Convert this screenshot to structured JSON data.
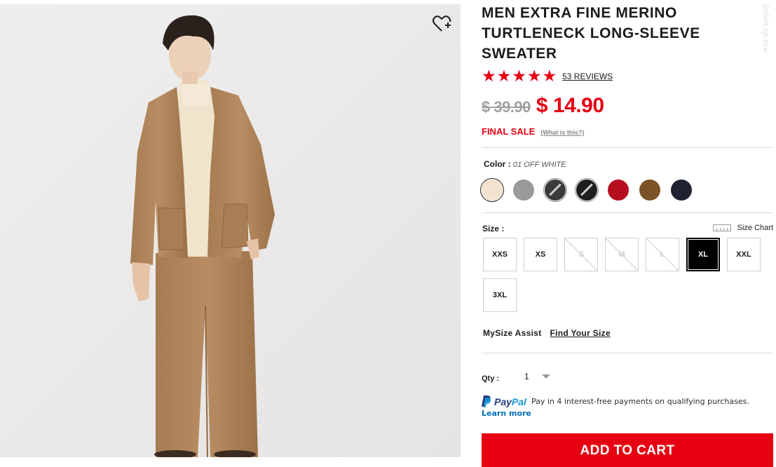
{
  "product": {
    "title": "MEN EXTRA FINE MERINO TURTLENECK LONG-SLEEVE SWEATER",
    "rating_stars": 5,
    "reviews": "53 REVIEWS",
    "original_price": "$ 39.90",
    "sale_price": "$ 14.90",
    "sale_label": "FINAL SALE",
    "sale_help": "(What is this?)",
    "watermark": "ladies.ep.nsw"
  },
  "color": {
    "label": "Color :",
    "selected": "01 OFF WHITE",
    "swatches": [
      {
        "name": "off-white",
        "hex": "#f2e3d0",
        "selected": true
      },
      {
        "name": "gray",
        "hex": "#9a9a9a"
      },
      {
        "name": "dark-gray",
        "hex": "#3a3a3a"
      },
      {
        "name": "black",
        "hex": "#1e1e1e"
      },
      {
        "name": "red",
        "hex": "#b50f1e"
      },
      {
        "name": "brown",
        "hex": "#7b5326"
      },
      {
        "name": "navy",
        "hex": "#1f2230"
      }
    ]
  },
  "size": {
    "label": "Size :",
    "chart_label": "Size Chart",
    "options": [
      {
        "label": "XXS",
        "available": true
      },
      {
        "label": "XS",
        "available": true
      },
      {
        "label": "S",
        "available": false
      },
      {
        "label": "M",
        "available": false
      },
      {
        "label": "L",
        "available": false
      },
      {
        "label": "XL",
        "available": true,
        "selected": true
      },
      {
        "label": "XXL",
        "available": true
      },
      {
        "label": "3XL",
        "available": true
      }
    ]
  },
  "mysize": {
    "label": "MySize Assist",
    "link": "Find Your Size"
  },
  "qty": {
    "label": "Qty :",
    "value": "1"
  },
  "paypal": {
    "brand_pay": "Pay",
    "brand_pal": "Pal",
    "message": "Pay in 4 interest-free payments on qualifying purchases.",
    "learn_more": "Learn more"
  },
  "cart": {
    "label": "ADD TO CART"
  },
  "colors": {
    "accent": "#e60012",
    "paypal_dark": "#253b80",
    "paypal_light": "#179bd7"
  }
}
